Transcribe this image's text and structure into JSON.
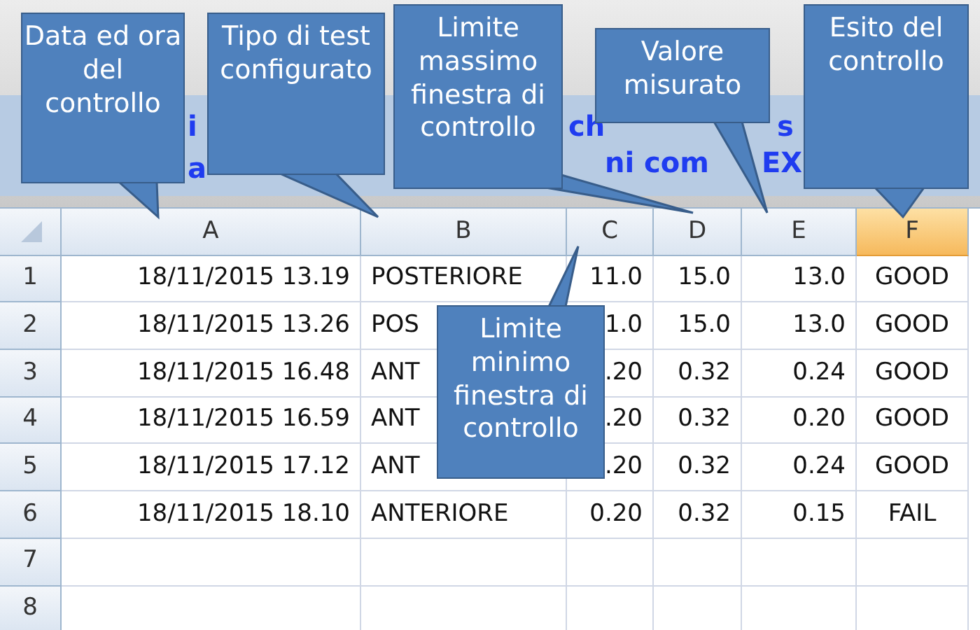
{
  "title_fragments": [
    {
      "text": "i"
    },
    {
      "text": "ch"
    },
    {
      "text": "s"
    },
    {
      "text": "a"
    },
    {
      "text": "ni com"
    },
    {
      "text": "EX"
    }
  ],
  "sheet": {
    "columns": [
      {
        "label": "A",
        "selected": false
      },
      {
        "label": "B",
        "selected": false
      },
      {
        "label": "C",
        "selected": false
      },
      {
        "label": "D",
        "selected": false
      },
      {
        "label": "E",
        "selected": false
      },
      {
        "label": "F",
        "selected": true
      }
    ],
    "rows": [
      {
        "number": "1",
        "cells": [
          "18/11/2015 13.19",
          "POSTERIORE",
          "11.0",
          "15.0",
          "13.0",
          "GOOD"
        ]
      },
      {
        "number": "2",
        "cells": [
          "18/11/2015 13.26",
          "POS",
          "1.0",
          "15.0",
          "13.0",
          "GOOD"
        ]
      },
      {
        "number": "3",
        "cells": [
          "18/11/2015 16.48",
          "ANT",
          ".20",
          "0.32",
          "0.24",
          "GOOD"
        ]
      },
      {
        "number": "4",
        "cells": [
          "18/11/2015 16.59",
          "ANT",
          ".20",
          "0.32",
          "0.20",
          "GOOD"
        ]
      },
      {
        "number": "5",
        "cells": [
          "18/11/2015 17.12",
          "ANT",
          ".20",
          "0.32",
          "0.24",
          "GOOD"
        ]
      },
      {
        "number": "6",
        "cells": [
          "18/11/2015 18.10",
          "ANTERIORE",
          "0.20",
          "0.32",
          "0.15",
          "FAIL"
        ]
      },
      {
        "number": "7",
        "cells": [
          "",
          "",
          "",
          "",
          "",
          ""
        ]
      },
      {
        "number": "8",
        "cells": [
          "",
          "",
          "",
          "",
          "",
          ""
        ]
      }
    ]
  },
  "callouts": [
    {
      "text": "Data ed ora del controllo"
    },
    {
      "text": "Tipo di test configurato"
    },
    {
      "text": "Limite massimo finestra di controllo"
    },
    {
      "text": "Valore misurato"
    },
    {
      "text": "Esito del controllo"
    },
    {
      "text": "Limite minimo finestra di controllo"
    }
  ]
}
